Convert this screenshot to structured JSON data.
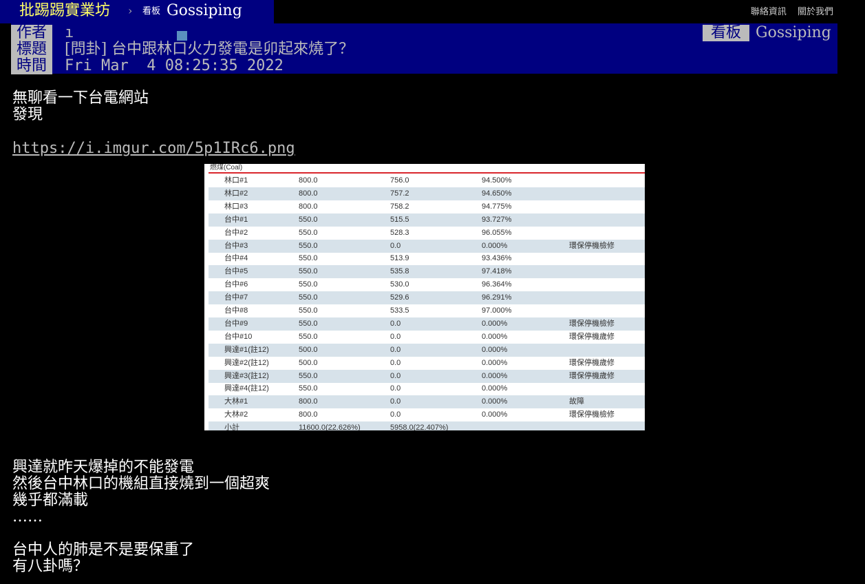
{
  "topbar": {
    "site_title": "批踢踢實業坊",
    "separator": "›",
    "board_label": "看板",
    "board_name": "Gossiping",
    "links": [
      "聯絡資訊",
      "關於我們"
    ]
  },
  "header": {
    "author_label": "作者",
    "author_value": "ı",
    "board_tag": "看板",
    "board_name": "Gossiping",
    "title_label": "標題",
    "title_value": "[問卦] 台中跟林口火力發電是卯起來燒了？",
    "time_label": "時間",
    "time_value": "Fri Mar  4 08:25:35 2022"
  },
  "body": {
    "para1": "無聊看一下台電網站\n發現",
    "link": "https://i.imgur.com/5p1IRc6.png",
    "para2": "興達就昨天爆掉的不能發電\n然後台中林口的機組直接燒到一個超爽\n幾乎都滿載\n……",
    "para3": "台中人的肺是不是要保重了\n有八卦嗎？"
  },
  "image_table": {
    "caption": "燃煤(Coal)",
    "rows": [
      [
        "林口#1",
        "800.0",
        "756.0",
        "94.500%",
        ""
      ],
      [
        "林口#2",
        "800.0",
        "757.2",
        "94.650%",
        ""
      ],
      [
        "林口#3",
        "800.0",
        "758.2",
        "94.775%",
        ""
      ],
      [
        "台中#1",
        "550.0",
        "515.5",
        "93.727%",
        ""
      ],
      [
        "台中#2",
        "550.0",
        "528.3",
        "96.055%",
        ""
      ],
      [
        "台中#3",
        "550.0",
        "0.0",
        "0.000%",
        "環保停機檢修"
      ],
      [
        "台中#4",
        "550.0",
        "513.9",
        "93.436%",
        ""
      ],
      [
        "台中#5",
        "550.0",
        "535.8",
        "97.418%",
        ""
      ],
      [
        "台中#6",
        "550.0",
        "530.0",
        "96.364%",
        ""
      ],
      [
        "台中#7",
        "550.0",
        "529.6",
        "96.291%",
        ""
      ],
      [
        "台中#8",
        "550.0",
        "533.5",
        "97.000%",
        ""
      ],
      [
        "台中#9",
        "550.0",
        "0.0",
        "0.000%",
        "環保停機檢修"
      ],
      [
        "台中#10",
        "550.0",
        "0.0",
        "0.000%",
        "環保停機歲修"
      ],
      [
        "興達#1(註12)",
        "500.0",
        "0.0",
        "0.000%",
        ""
      ],
      [
        "興達#2(註12)",
        "500.0",
        "0.0",
        "0.000%",
        "環保停機歲修"
      ],
      [
        "興達#3(註12)",
        "550.0",
        "0.0",
        "0.000%",
        "環保停機歲修"
      ],
      [
        "興達#4(註12)",
        "550.0",
        "0.0",
        "0.000%",
        ""
      ],
      [
        "大林#1",
        "800.0",
        "0.0",
        "0.000%",
        "故障"
      ],
      [
        "大林#2",
        "800.0",
        "0.0",
        "0.000%",
        "環保停機檢修"
      ],
      [
        "小計",
        "11600.0(22.626%)",
        "5958.0(22.407%)",
        "",
        ""
      ]
    ]
  }
}
